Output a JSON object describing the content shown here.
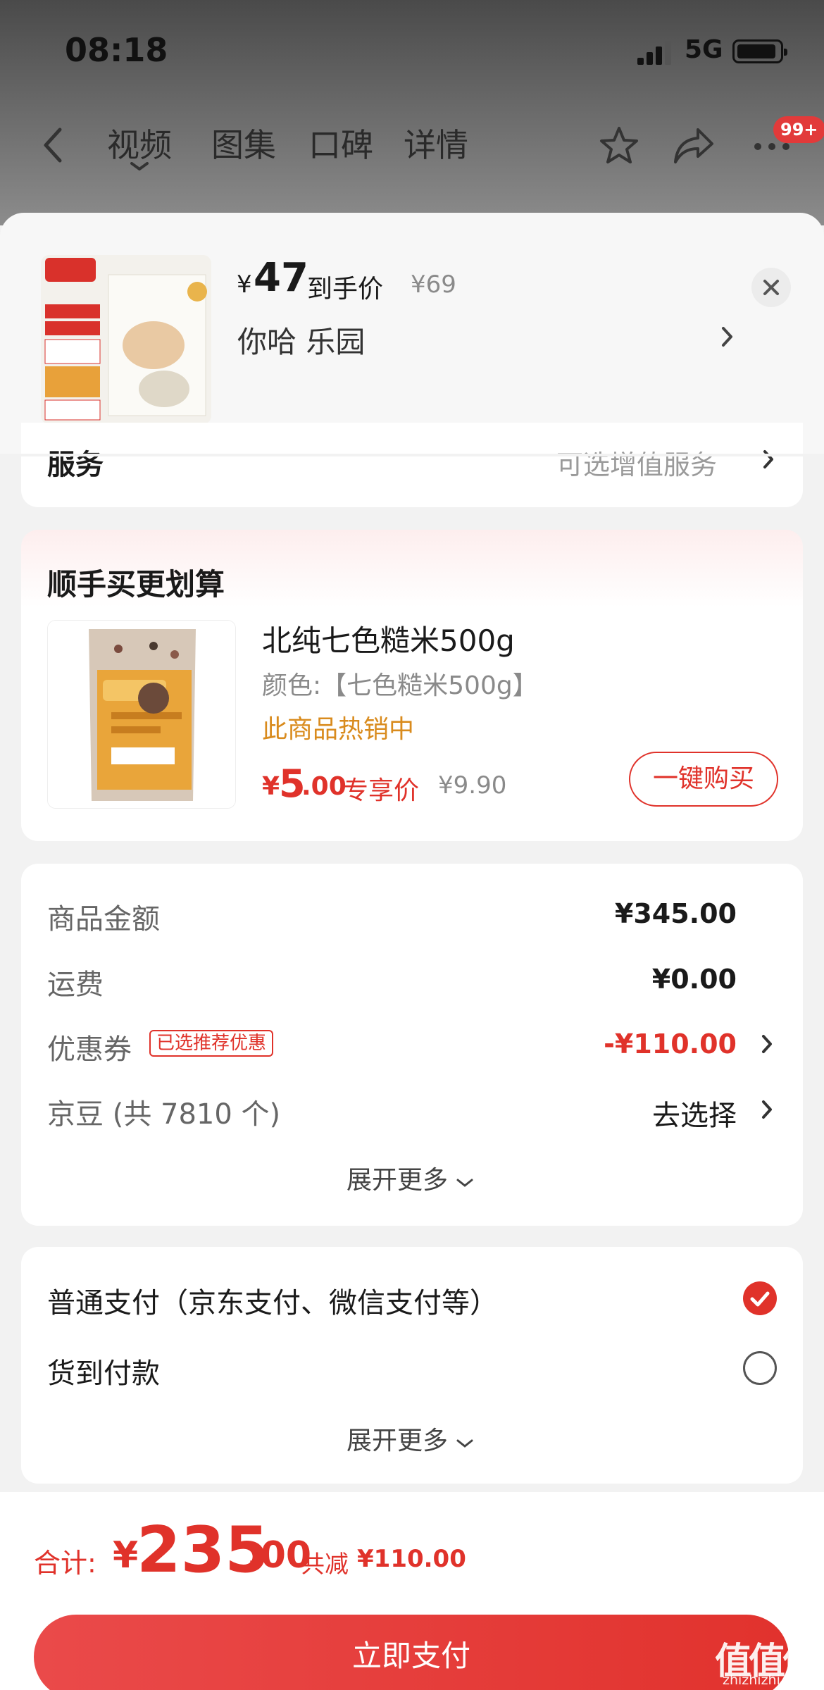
{
  "status_bar": {
    "time": "08:18",
    "network": "5G"
  },
  "nav": {
    "tabs": [
      "视频",
      "图集",
      "口碑",
      "详情"
    ],
    "badge": "99+"
  },
  "product": {
    "price_symbol": "¥",
    "price": "47",
    "price_label": "到手价",
    "original_price": "¥69",
    "name": "你哈  乐园"
  },
  "service": {
    "title": "服务",
    "value": "可选增值服务"
  },
  "upsell": {
    "title": "顺手买更划算",
    "name": "北纯七色糙米500g",
    "variant": "颜色:【七色糙米500g】",
    "hot": "此商品热销中",
    "price_symbol": "¥",
    "price_int": "5",
    "price_dec": ".00",
    "price_label": "专享价",
    "original_price": "¥9.90",
    "buy_label": "一键购买"
  },
  "summary": {
    "goods_label": "商品金额",
    "goods_value": "¥345.00",
    "shipping_label": "运费",
    "shipping_value": "¥0.00",
    "coupon_label": "优惠券",
    "coupon_tag": "已选推荐优惠",
    "coupon_value": "-¥110.00",
    "beans_label": "京豆 (共 7810 个)",
    "beans_value": "去选择",
    "expand_label": "展开更多"
  },
  "payment": {
    "option1": "普通支付（京东支付、微信支付等）",
    "option2": "货到付款",
    "expand_label": "展开更多"
  },
  "footer": {
    "total_label": "合计:",
    "total_symbol": "¥",
    "total_int": "235",
    "total_dec": ".00",
    "save_label": "共减",
    "save_value": "¥110.00",
    "pay_label": "立即支付"
  },
  "watermark": {
    "logo": "值值值",
    "url": "zhizhizhi.com"
  },
  "colors": {
    "accent": "#e0322a",
    "hot": "#d98b1d"
  }
}
